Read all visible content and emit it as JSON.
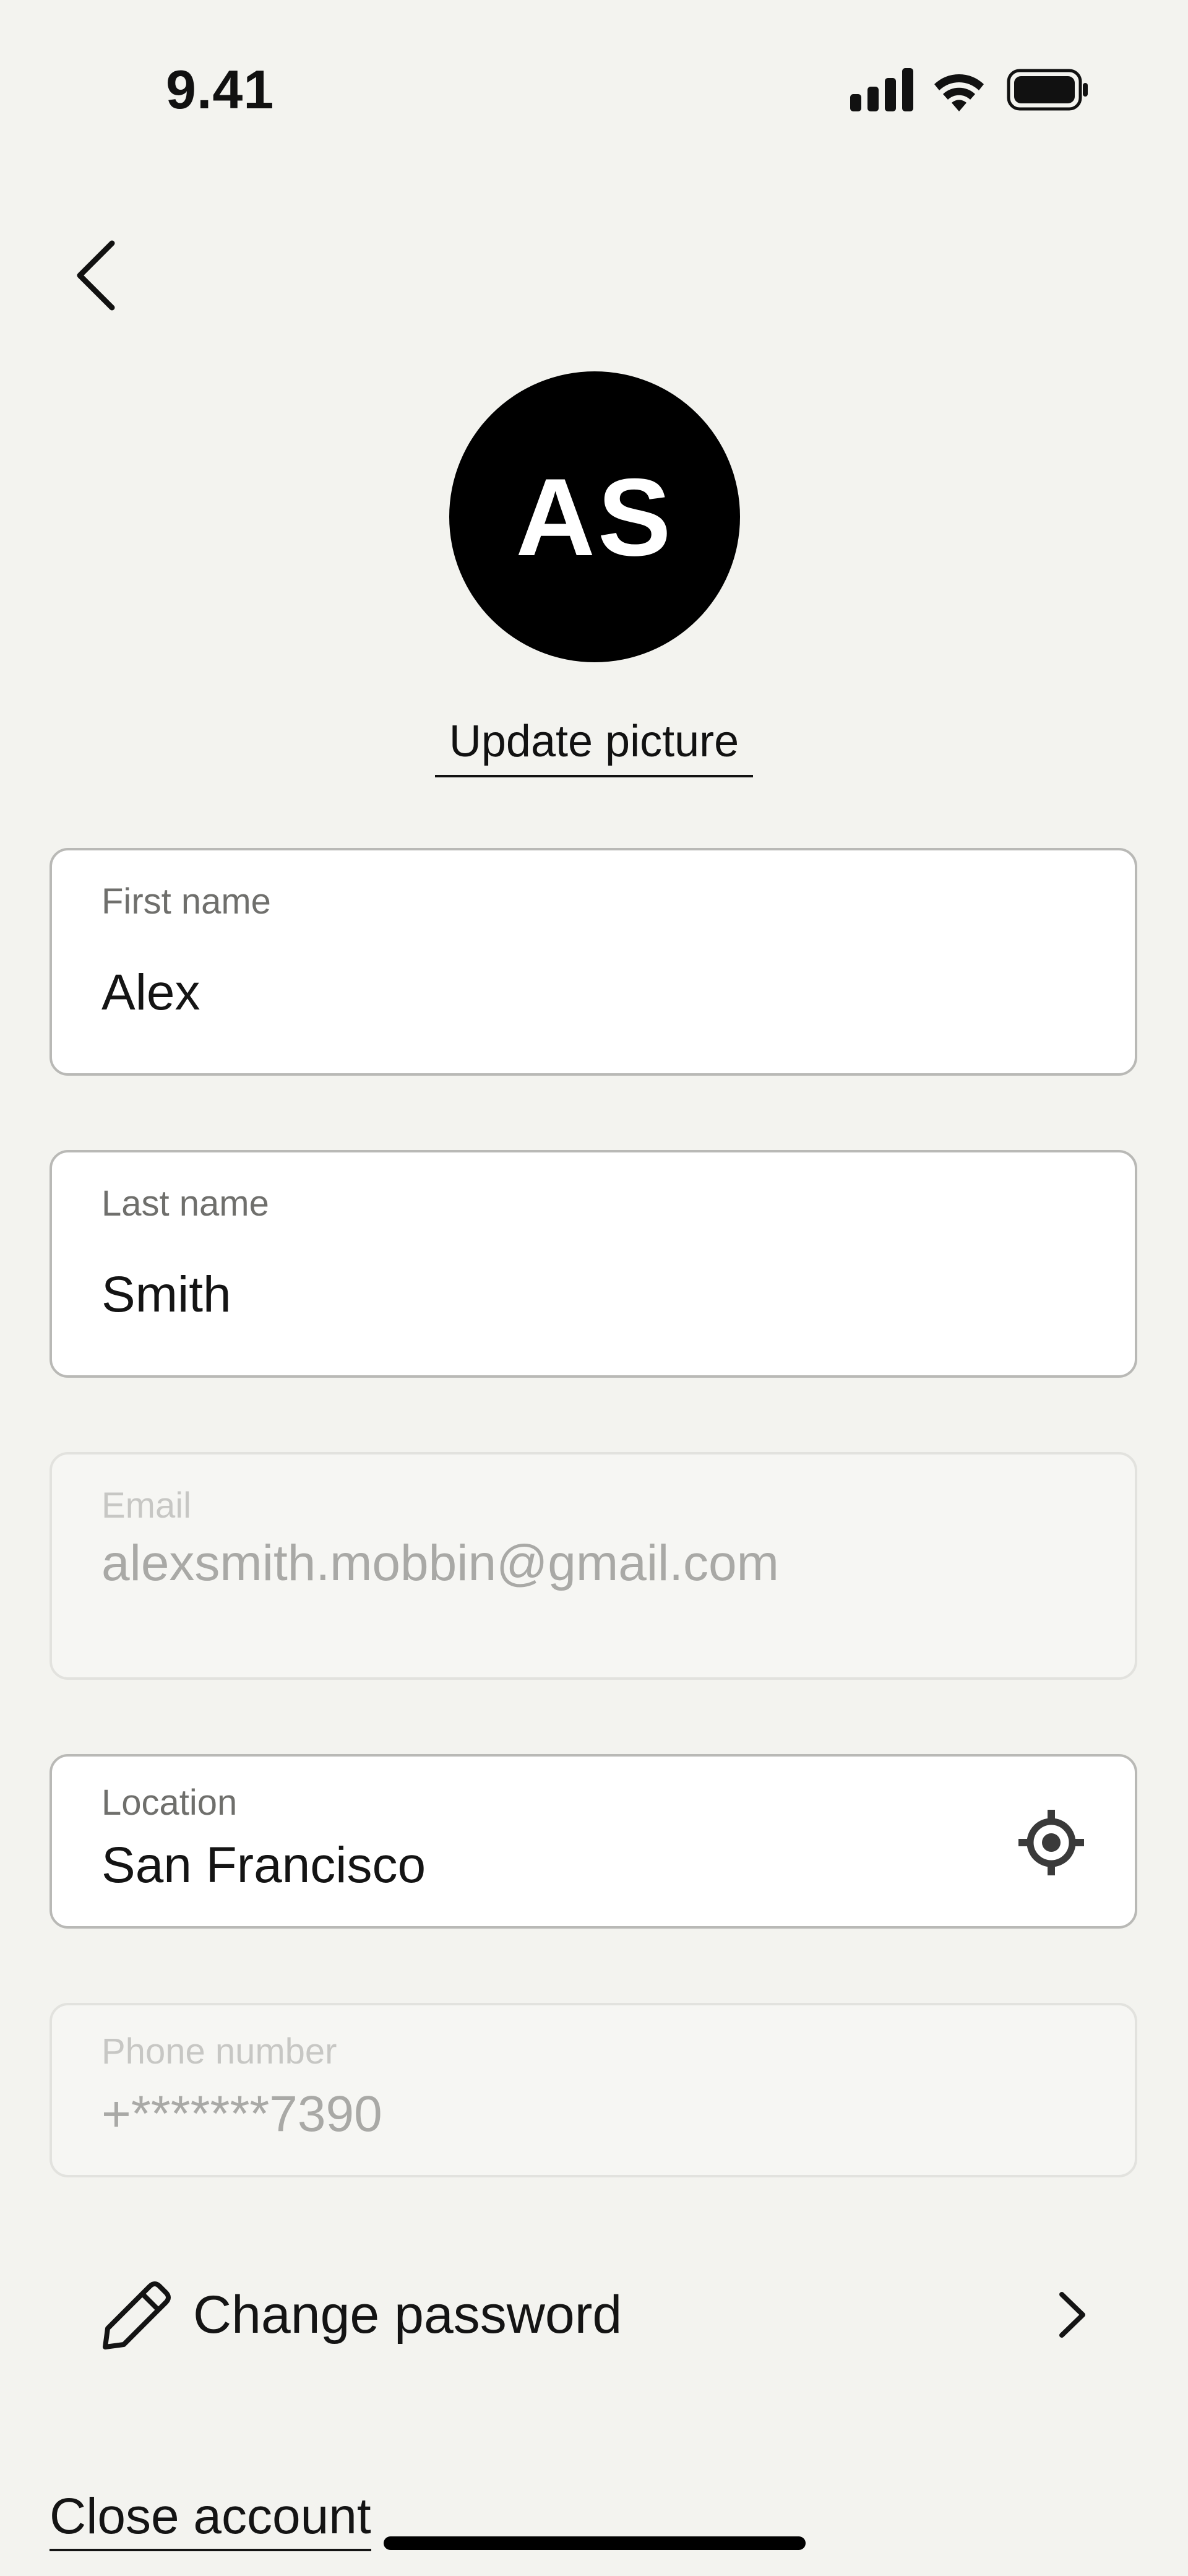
{
  "status_bar": {
    "time": "9.41",
    "icons": [
      "signal-icon",
      "wifi-icon",
      "battery-icon"
    ]
  },
  "nav": {
    "back_icon": "chevron-left-icon"
  },
  "profile": {
    "initials": "AS",
    "update_picture_label": "Update picture"
  },
  "form": {
    "first_name": {
      "label": "First name",
      "value": "Alex"
    },
    "last_name": {
      "label": "Last name",
      "value": "Smith"
    },
    "email": {
      "label": "Email",
      "value": "alexsmith.mobbin@gmail.com",
      "disabled": true
    },
    "location": {
      "label": "Location",
      "value": "San Francisco",
      "icon": "crosshair-icon"
    },
    "phone": {
      "label": "Phone number",
      "value": "+*******7390",
      "disabled": true
    }
  },
  "actions": {
    "change_password_label": "Change password",
    "close_account_label": "Close account"
  },
  "colors": {
    "background": "#f3f3ef",
    "avatar": "#000000",
    "field_border": "#b9b9b6",
    "disabled_field": "#f6f6f3"
  }
}
